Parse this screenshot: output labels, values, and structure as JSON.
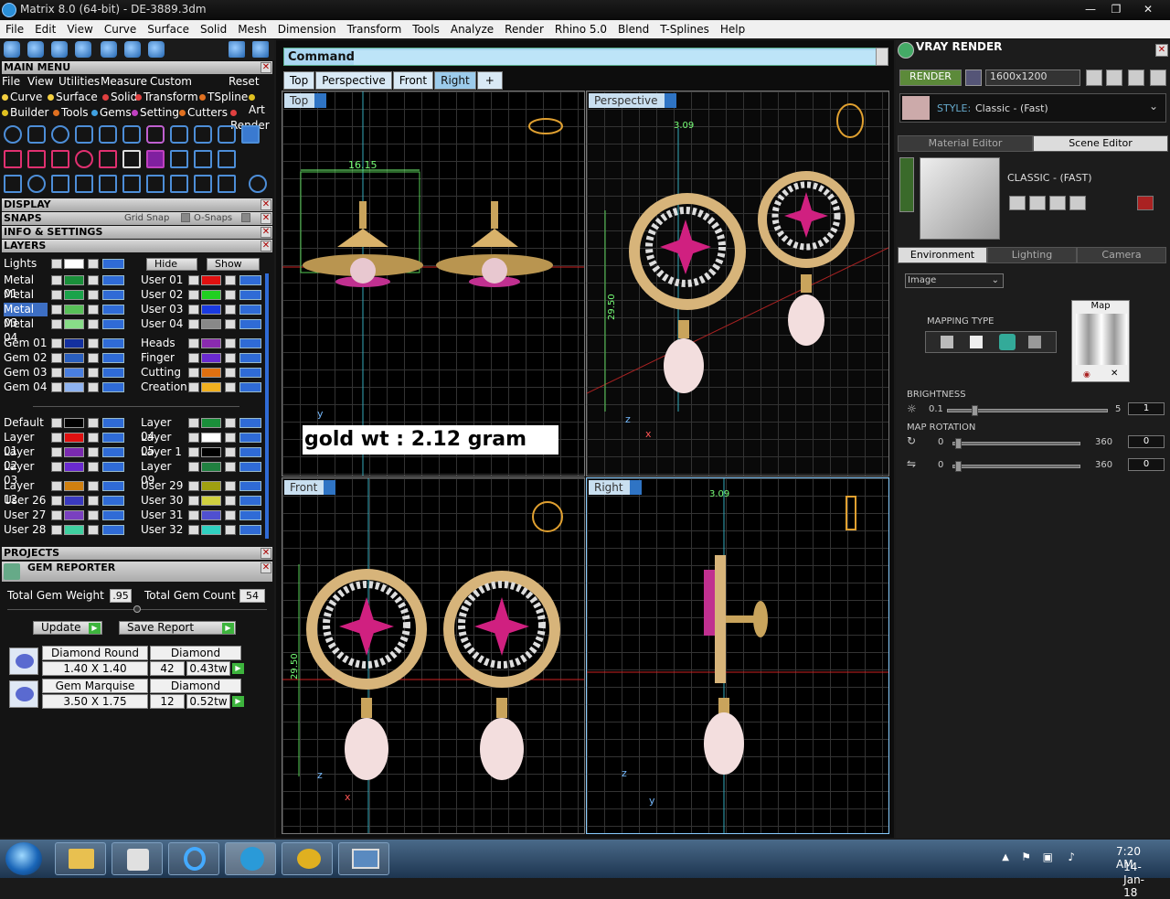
{
  "window": {
    "title": "Matrix 8.0 (64-bit) - DE-3889.3dm",
    "min": "—",
    "max": "❐",
    "close": "✕"
  },
  "menubar": [
    "File",
    "Edit",
    "View",
    "Curve",
    "Surface",
    "Solid",
    "Mesh",
    "Dimension",
    "Transform",
    "Tools",
    "Analyze",
    "Render",
    "Rhino 5.0",
    "Blend",
    "T-Splines",
    "Help"
  ],
  "left": {
    "main_menu": "MAIN MENU",
    "sub_menu": [
      "File",
      "View",
      "Utilities",
      "Measure",
      "Custom"
    ],
    "reset": "Reset",
    "row2": [
      "Curve",
      "Surface",
      "Solid",
      "Transform",
      "TSpline",
      "Art"
    ],
    "row3": [
      "Builder",
      "Tools",
      "Gems",
      "Setting",
      "Cutters",
      "Render"
    ],
    "display": "DISPLAY",
    "snaps": "SNAPS",
    "grid_snap": "Grid Snap",
    "o_snaps": "O-Snaps",
    "info": "INFO & SETTINGS",
    "layers": "LAYERS",
    "lights": "Lights",
    "hide": "Hide",
    "show": "Show",
    "layers_left": [
      "Metal 01",
      "Metal 02",
      "Metal 03",
      "Metal 04",
      "Gem 01",
      "Gem 02",
      "Gem 03",
      "Gem 04",
      "Default",
      "Layer 01",
      "Layer 02",
      "Layer 03",
      "Layer 12",
      "User 26",
      "User 27",
      "User 28"
    ],
    "layers_left_colors": [
      "#1a8f3a",
      "#1aa34a",
      "#58c058",
      "#88dd88",
      "#1330a0",
      "#2a5fbf",
      "#4a7fe0",
      "#8fb3f0",
      "#000000",
      "#e01010",
      "#7a2ab0",
      "#6a2ad0",
      "#d08010",
      "#3a3abf",
      "#7a40c0",
      "#40d0a0"
    ],
    "layers_right": [
      "User 01",
      "User 02",
      "User 03",
      "User 04",
      "Heads",
      "Finger",
      "Cutting",
      "Creation",
      "Layer 04",
      "Layer 05",
      "Layer 1",
      "Layer 09",
      "User 29",
      "User 30",
      "User 31",
      "User 32"
    ],
    "layers_right_colors": [
      "#e01010",
      "#20d020",
      "#1a3ae0",
      "#888888",
      "#8a2ab0",
      "#6a2ad0",
      "#e07010",
      "#f0b020",
      "#1a8f3a",
      "#ffffff",
      "#000000",
      "#208040",
      "#a0a010",
      "#d0d040",
      "#5050d0",
      "#30d0c0"
    ],
    "projects": "PROJECTS",
    "gem_reporter": "GEM REPORTER",
    "total_gem_weight_label": "Total Gem Weight",
    "total_gem_weight": ".95",
    "total_gem_count_label": "Total Gem Count",
    "total_gem_count": "54",
    "update": "Update",
    "save_report": "Save Report",
    "gems": [
      {
        "name": "Diamond Round",
        "size": "1.40 X 1.40",
        "material": "Diamond",
        "count": "42",
        "weight": "0.43tw"
      },
      {
        "name": "Gem Marquise",
        "size": "3.50 X 1.75",
        "material": "Diamond",
        "count": "12",
        "weight": "0.52tw"
      }
    ]
  },
  "center": {
    "command_label": "Command:",
    "tabs": [
      "Top",
      "Perspective",
      "Front",
      "Right",
      "+"
    ],
    "active_tab": "Right",
    "viewports": {
      "top": "Top",
      "perspective": "Perspective",
      "front": "Front",
      "right": "Right"
    },
    "gold_wt": "gold wt : 2.12 gram",
    "dims": {
      "top_width": "16.15",
      "persp_height": "29.50",
      "persp_small": "3.09",
      "front_height": "29.50",
      "right_width": "3.09"
    },
    "axis": {
      "x": "x",
      "y": "y",
      "z": "z"
    }
  },
  "right": {
    "title": "VRAY RENDER",
    "render": "RENDER",
    "resolution": "1600x1200",
    "style_label": "STYLE:",
    "style_value": "Classic - (Fast)",
    "tabs_top": [
      "Material Editor",
      "Scene Editor"
    ],
    "classic": "CLASSIC - (FAST)",
    "tabs_env": [
      "Environment",
      "Lighting",
      "Camera"
    ],
    "env_select": "Image",
    "map": "Map",
    "mapping_type": "MAPPING TYPE",
    "brightness": "BRIGHTNESS",
    "brightness_min": "0.1",
    "brightness_max": "5",
    "brightness_val": "1",
    "map_rotation": "MAP ROTATION",
    "rot1_min": "0",
    "rot1_max": "360",
    "rot1_val": "0",
    "rot2_min": "0",
    "rot2_max": "360",
    "rot2_val": "0"
  },
  "taskbar": {
    "time": "7:20 AM",
    "date": "14-Jan-18"
  }
}
